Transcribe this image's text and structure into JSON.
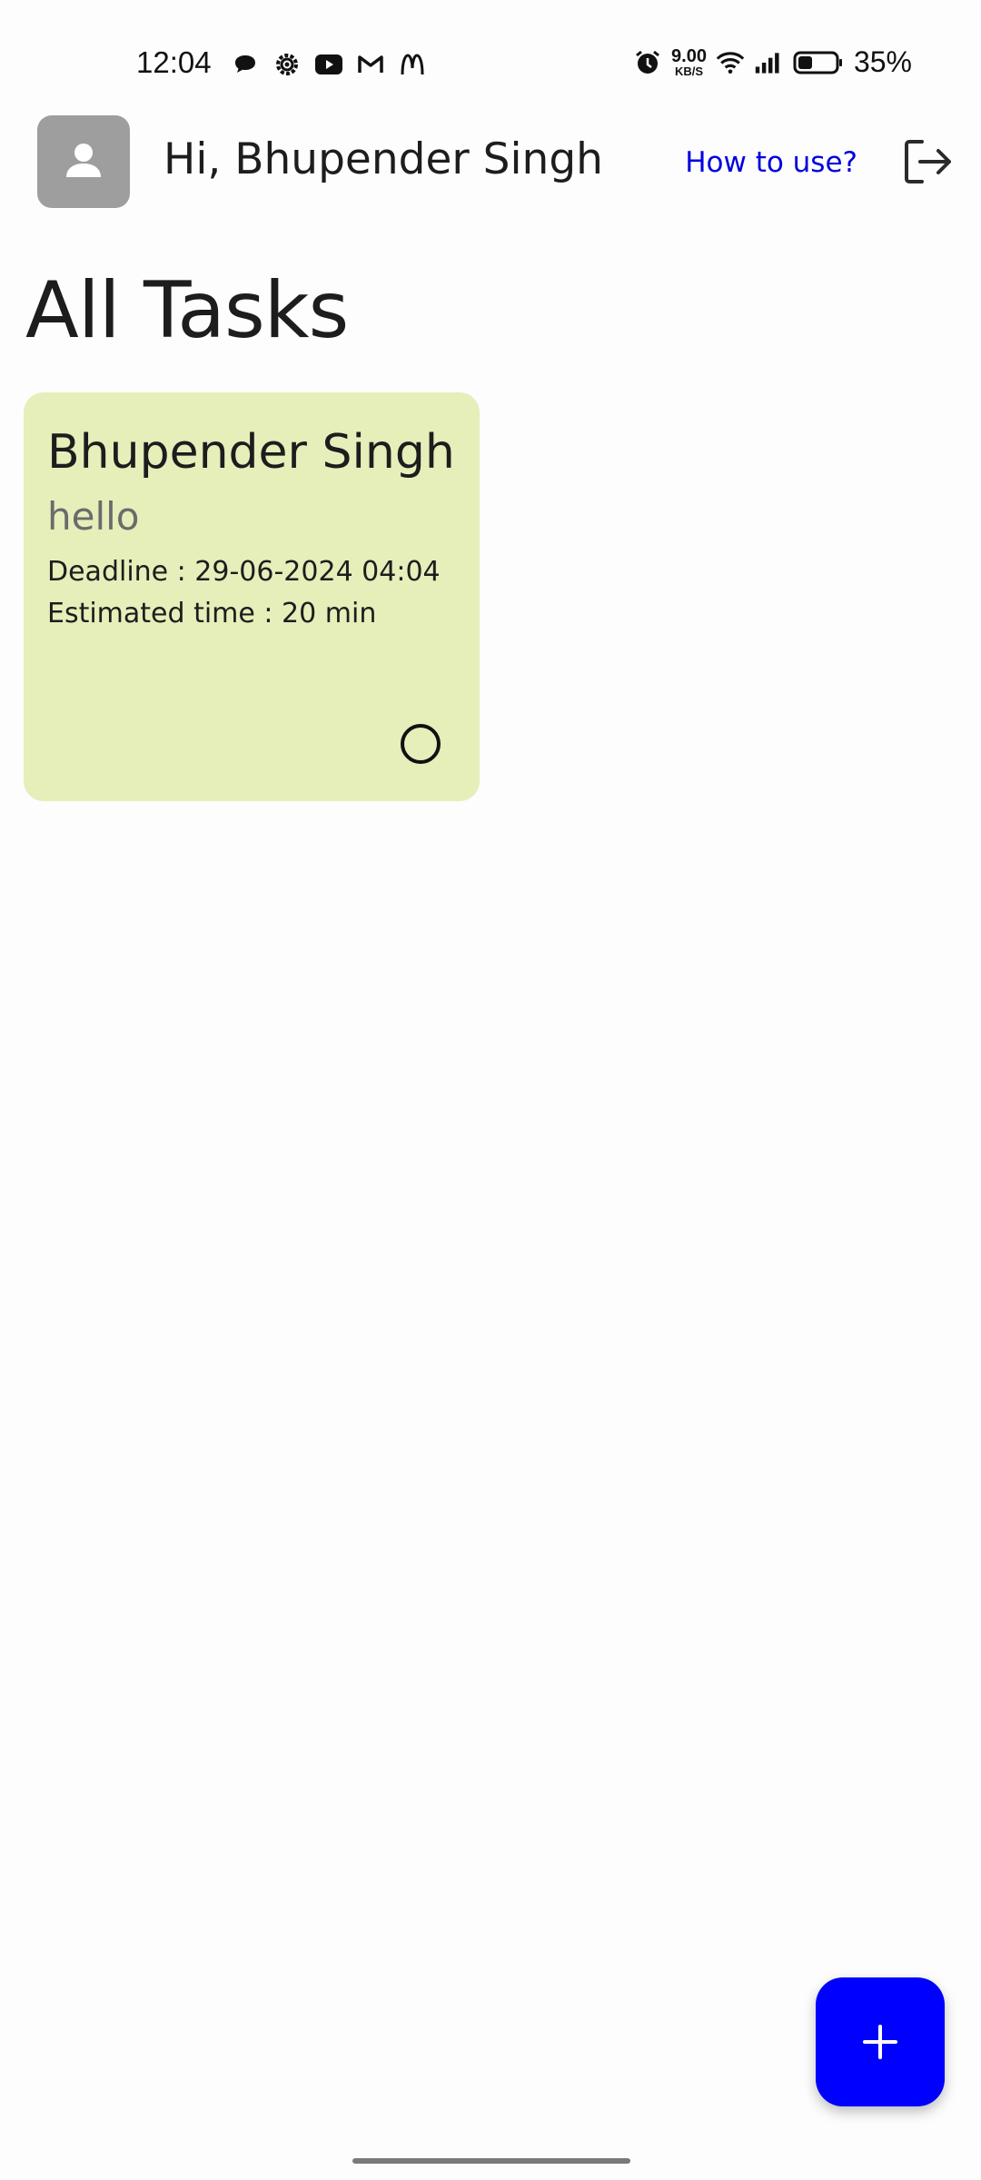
{
  "status_bar": {
    "time": "12:04",
    "net_speed_value": "9.00",
    "net_speed_unit": "KB/S",
    "battery_percent": "35%",
    "left_icons": [
      "chat-bubble-icon",
      "settings-gear-icon",
      "youtube-icon",
      "gmail-icon",
      "mcdonalds-icon"
    ],
    "right_icons": [
      "alarm-icon",
      "wifi-icon",
      "signal-icon",
      "battery-icon"
    ]
  },
  "header": {
    "greeting": "Hi, Bhupender Singh",
    "how_to_use": "How to use?",
    "avatar_icon": "user-icon",
    "logout_icon": "logout-icon",
    "link_color": "#0000e0"
  },
  "page": {
    "title": "All Tasks"
  },
  "tasks": [
    {
      "title": "Bhupender Singh",
      "description": "hello",
      "deadline": "Deadline : 29-06-2024 04:04",
      "estimate": "Estimated time : 20 min",
      "completed": false,
      "card_color": "#e6eeba"
    }
  ],
  "fab": {
    "icon": "plus-icon",
    "color": "#0000ff"
  }
}
